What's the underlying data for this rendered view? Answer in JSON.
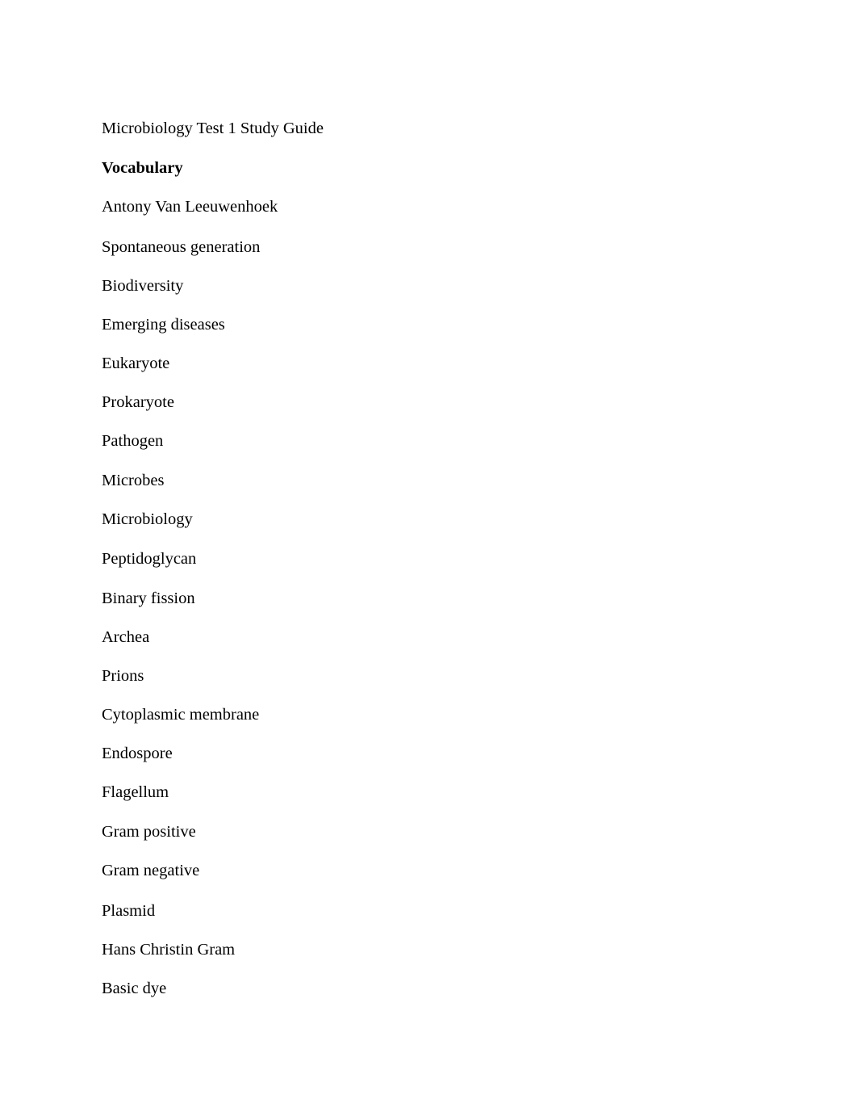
{
  "document": {
    "title": "Microbiology Test 1 Study Guide",
    "section_heading": "Vocabulary",
    "terms": [
      "Antony Van Leeuwenhoek",
      "Spontaneous generation",
      "Biodiversity",
      "Emerging diseases",
      "Eukaryote",
      "Prokaryote",
      "Pathogen",
      "Microbes",
      "Microbiology",
      "Peptidoglycan",
      "Binary fission",
      "Archea",
      "Prions",
      "Cytoplasmic membrane",
      "Endospore",
      "Flagellum",
      "Gram positive",
      "Gram negative",
      "Plasmid",
      "Hans Christin Gram",
      "Basic dye"
    ]
  }
}
